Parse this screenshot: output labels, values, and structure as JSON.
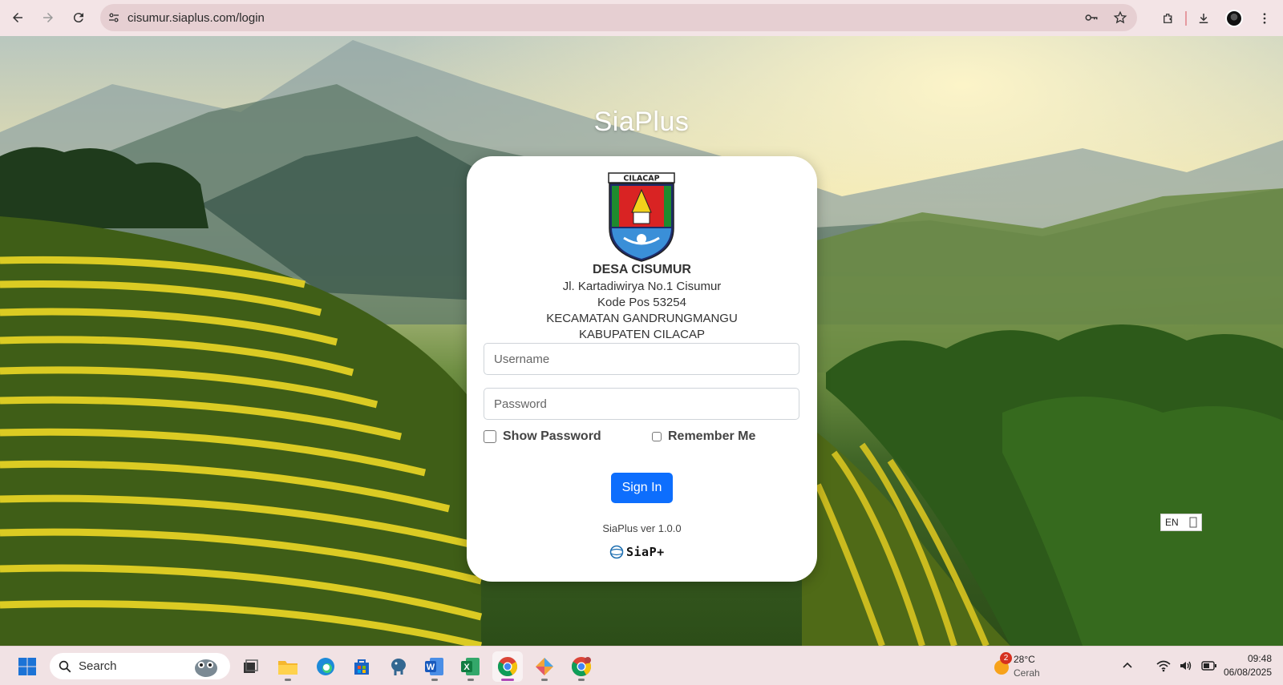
{
  "browser": {
    "url": "cisumur.siaplus.com/login"
  },
  "page": {
    "brand_title": "SiaPlus",
    "logo_text": "CILACAP",
    "org_name": "DESA CISUMUR",
    "address_lines": [
      "Jl. Kartadiwirya No.1 Cisumur",
      "Kode Pos 53254",
      "KECAMATAN GANDRUNGMANGU",
      "KABUPATEN CILACAP"
    ],
    "username_placeholder": "Username",
    "password_placeholder": "Password",
    "show_password_label": "Show Password",
    "remember_me_label": "Remember Me",
    "signin_label": "Sign In",
    "version_text": "SiaPlus ver 1.0.0",
    "footer_logo_text": "SiaP+",
    "lang_badge": "EN",
    "primary_color": "#0d6efd"
  },
  "taskbar": {
    "search_label": "Search",
    "weather_badge": "2",
    "weather_temp": "28°C",
    "weather_desc": "Cerah",
    "time": "09:48",
    "date": "06/08/2025"
  },
  "icons": {
    "browser": [
      "back-icon",
      "forward-icon",
      "reload-icon",
      "site-info-icon",
      "password-key-icon",
      "star-icon",
      "extensions-icon",
      "download-icon",
      "profile-avatar",
      "menu-icon"
    ],
    "taskbar": [
      "windows-start-icon",
      "search-icon",
      "task-view-icon",
      "file-explorer-icon",
      "edge-icon",
      "store-icon",
      "postgres-icon",
      "word-icon",
      "excel-icon",
      "chrome-icon",
      "app-icon",
      "chrome-alt-icon"
    ]
  }
}
